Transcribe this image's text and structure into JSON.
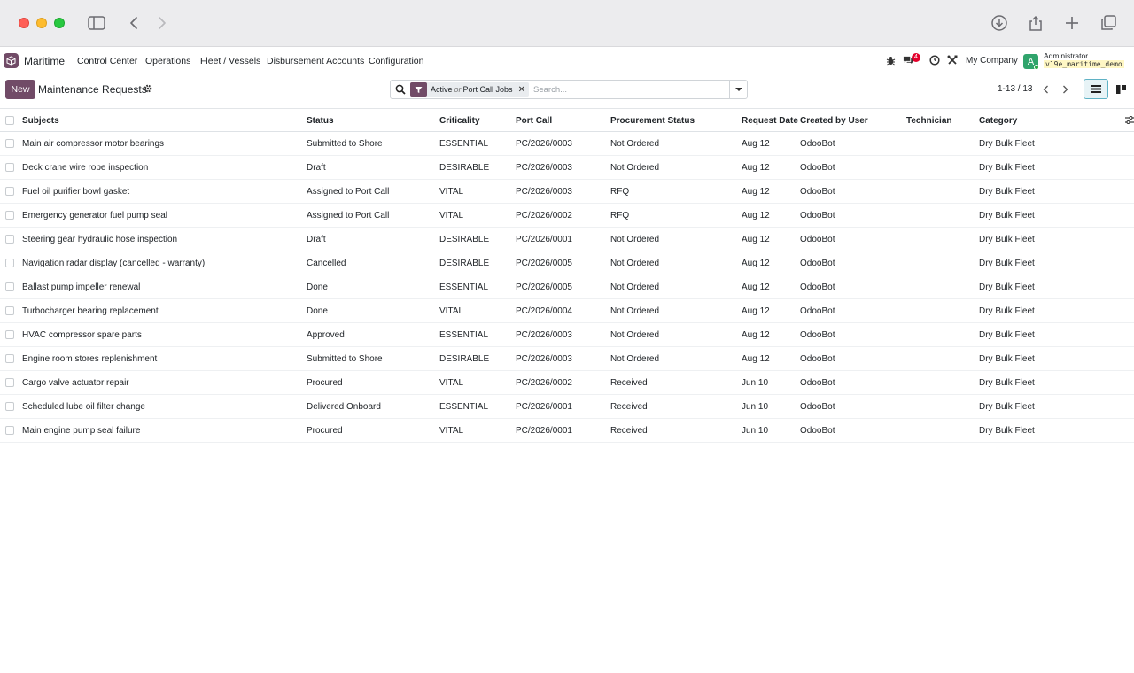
{
  "app": {
    "name": "Maritime",
    "menus": [
      "Control Center",
      "Operations",
      "Fleet / Vessels",
      "Disbursement Accounts",
      "Configuration"
    ],
    "notification_count": "4",
    "company": "My Company",
    "user_initial": "A",
    "user_name": "Administrator",
    "database": "v19e_maritime_demo"
  },
  "control_panel": {
    "new_label": "New",
    "title": "Maintenance Requests",
    "facet_first": "Active",
    "facet_or": "or",
    "facet_second": "Port Call Jobs",
    "search_placeholder": "Search...",
    "pager": "1-13 / 13"
  },
  "table": {
    "columns": [
      "Subjects",
      "Status",
      "Criticality",
      "Port Call",
      "Procurement Status",
      "Request Date",
      "Created by User",
      "Technician",
      "Category"
    ],
    "rows": [
      {
        "subject": "Main air compressor motor bearings",
        "status": "Submitted to Shore",
        "criticality": "ESSENTIAL",
        "port_call": "PC/2026/0003",
        "procurement": "Not Ordered",
        "date": "Aug 12",
        "created_by": "OdooBot",
        "technician": "",
        "category": "Dry Bulk Fleet"
      },
      {
        "subject": "Deck crane wire rope inspection",
        "status": "Draft",
        "criticality": "DESIRABLE",
        "port_call": "PC/2026/0003",
        "procurement": "Not Ordered",
        "date": "Aug 12",
        "created_by": "OdooBot",
        "technician": "",
        "category": "Dry Bulk Fleet"
      },
      {
        "subject": "Fuel oil purifier bowl gasket",
        "status": "Assigned to Port Call",
        "criticality": "VITAL",
        "port_call": "PC/2026/0003",
        "procurement": "RFQ",
        "date": "Aug 12",
        "created_by": "OdooBot",
        "technician": "",
        "category": "Dry Bulk Fleet"
      },
      {
        "subject": "Emergency generator fuel pump seal",
        "status": "Assigned to Port Call",
        "criticality": "VITAL",
        "port_call": "PC/2026/0002",
        "procurement": "RFQ",
        "date": "Aug 12",
        "created_by": "OdooBot",
        "technician": "",
        "category": "Dry Bulk Fleet"
      },
      {
        "subject": "Steering gear hydraulic hose inspection",
        "status": "Draft",
        "criticality": "DESIRABLE",
        "port_call": "PC/2026/0001",
        "procurement": "Not Ordered",
        "date": "Aug 12",
        "created_by": "OdooBot",
        "technician": "",
        "category": "Dry Bulk Fleet"
      },
      {
        "subject": "Navigation radar display (cancelled - warranty)",
        "status": "Cancelled",
        "criticality": "DESIRABLE",
        "port_call": "PC/2026/0005",
        "procurement": "Not Ordered",
        "date": "Aug 12",
        "created_by": "OdooBot",
        "technician": "",
        "category": "Dry Bulk Fleet"
      },
      {
        "subject": "Ballast pump impeller renewal",
        "status": "Done",
        "criticality": "ESSENTIAL",
        "port_call": "PC/2026/0005",
        "procurement": "Not Ordered",
        "date": "Aug 12",
        "created_by": "OdooBot",
        "technician": "",
        "category": "Dry Bulk Fleet"
      },
      {
        "subject": "Turbocharger bearing replacement",
        "status": "Done",
        "criticality": "VITAL",
        "port_call": "PC/2026/0004",
        "procurement": "Not Ordered",
        "date": "Aug 12",
        "created_by": "OdooBot",
        "technician": "",
        "category": "Dry Bulk Fleet"
      },
      {
        "subject": "HVAC compressor spare parts",
        "status": "Approved",
        "criticality": "ESSENTIAL",
        "port_call": "PC/2026/0003",
        "procurement": "Not Ordered",
        "date": "Aug 12",
        "created_by": "OdooBot",
        "technician": "",
        "category": "Dry Bulk Fleet"
      },
      {
        "subject": "Engine room stores replenishment",
        "status": "Submitted to Shore",
        "criticality": "DESIRABLE",
        "port_call": "PC/2026/0003",
        "procurement": "Not Ordered",
        "date": "Aug 12",
        "created_by": "OdooBot",
        "technician": "",
        "category": "Dry Bulk Fleet"
      },
      {
        "subject": "Cargo valve actuator repair",
        "status": "Procured",
        "criticality": "VITAL",
        "port_call": "PC/2026/0002",
        "procurement": "Received",
        "date": "Jun 10",
        "created_by": "OdooBot",
        "technician": "",
        "category": "Dry Bulk Fleet"
      },
      {
        "subject": "Scheduled lube oil filter change",
        "status": "Delivered Onboard",
        "criticality": "ESSENTIAL",
        "port_call": "PC/2026/0001",
        "procurement": "Received",
        "date": "Jun 10",
        "created_by": "OdooBot",
        "technician": "",
        "category": "Dry Bulk Fleet"
      },
      {
        "subject": "Main engine pump seal failure",
        "status": "Procured",
        "criticality": "VITAL",
        "port_call": "PC/2026/0001",
        "procurement": "Received",
        "date": "Jun 10",
        "created_by": "OdooBot",
        "technician": "",
        "category": "Dry Bulk Fleet"
      }
    ]
  },
  "colors": {
    "brand": "#714b67",
    "badge": "#e4002b",
    "avatar": "#30a46c",
    "active_view": "#5fb2c5"
  },
  "icons": [
    "sidebar-icon",
    "back-icon",
    "forward-icon",
    "download-icon",
    "share-icon",
    "new-tab-icon",
    "tabs-icon",
    "bug-icon",
    "chat-icon",
    "clock-icon",
    "tools-icon",
    "gear-icon",
    "search-icon",
    "filter-icon",
    "close-icon",
    "caret-down-icon",
    "list-view-icon",
    "kanban-view-icon",
    "column-options-icon"
  ]
}
